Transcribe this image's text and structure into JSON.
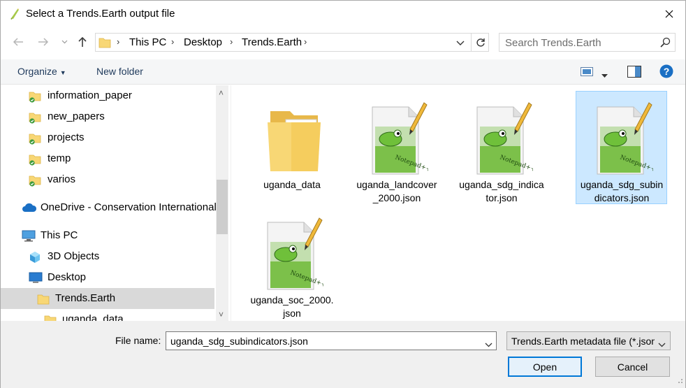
{
  "window": {
    "title": "Select a Trends.Earth output file"
  },
  "address": {
    "breadcrumbs": [
      "This PC",
      "Desktop",
      "Trends.Earth"
    ]
  },
  "search": {
    "placeholder": "Search Trends.Earth"
  },
  "toolbar": {
    "organize_label": "Organize",
    "new_folder_label": "New folder"
  },
  "nav": {
    "items": [
      {
        "label": "information_paper",
        "icon": "folder-synced-icon"
      },
      {
        "label": "new_papers",
        "icon": "folder-synced-icon"
      },
      {
        "label": "projects",
        "icon": "folder-synced-icon"
      },
      {
        "label": "temp",
        "icon": "folder-synced-icon"
      },
      {
        "label": "varios",
        "icon": "folder-synced-icon"
      },
      {
        "label": "OneDrive - Conservation International",
        "icon": "onedrive-icon"
      },
      {
        "label": "This PC",
        "icon": "computer-icon"
      },
      {
        "label": "3D Objects",
        "icon": "3d-objects-icon"
      },
      {
        "label": "Desktop",
        "icon": "desktop-icon"
      },
      {
        "label": "Trends.Earth",
        "icon": "folder-icon"
      },
      {
        "label": "uganda_data",
        "icon": "folder-icon"
      }
    ]
  },
  "files": {
    "items": [
      {
        "name": "uganda_data",
        "type": "folder"
      },
      {
        "name": "uganda_landcover_2000.json",
        "type": "notepadpp"
      },
      {
        "name": "uganda_sdg_indicator.json",
        "type": "notepadpp"
      },
      {
        "name": "uganda_sdg_subindicators.json",
        "type": "notepadpp"
      },
      {
        "name": "uganda_soc_2000.json",
        "type": "notepadpp"
      }
    ],
    "selected": "uganda_sdg_subindicators.json"
  },
  "bottom": {
    "file_name_label": "File name:",
    "file_name_value": "uganda_sdg_subindicators.json",
    "file_type": "Trends.Earth metadata file (*.json)",
    "open_label": "Open",
    "cancel_label": "Cancel"
  },
  "colors": {
    "accent": "#0078d7",
    "selection": "#cce8ff",
    "toolbar_text": "#1e395b"
  }
}
